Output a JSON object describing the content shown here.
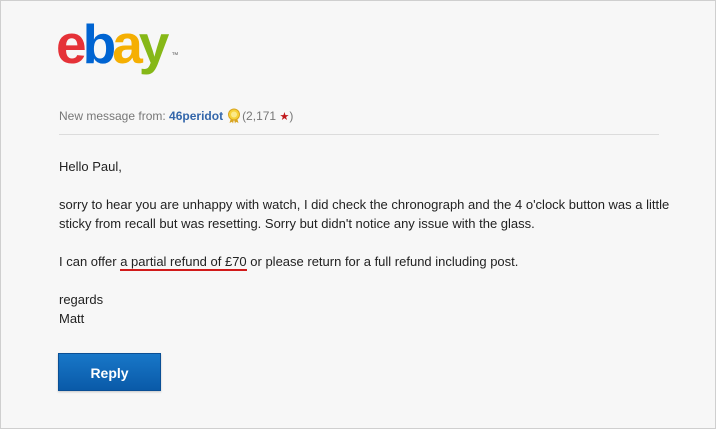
{
  "logo": {
    "letters": [
      {
        "char": "e",
        "color": "#e53238"
      },
      {
        "char": "b",
        "color": "#0064d2"
      },
      {
        "char": "a",
        "color": "#f5af02"
      },
      {
        "char": "y",
        "color": "#86b817"
      }
    ],
    "tm": "™"
  },
  "header": {
    "prefix": "New message from:",
    "sender": "46peridot",
    "feedback_open": "(2,171",
    "feedback_close": ")",
    "star": "★"
  },
  "message": {
    "greeting": "Hello Paul,",
    "para1": "sorry to hear you are unhappy with watch, I did check the chronograph and the 4 o'clock button was a little sticky from recall but was resetting. Sorry but didn't notice any issue with the glass.",
    "para2_before": "I can offer ",
    "para2_highlight": "a partial refund of £70",
    "para2_after": " or please return for a full refund including post.",
    "signoff": "regards",
    "signature": "Matt"
  },
  "actions": {
    "reply_label": "Reply"
  },
  "colors": {
    "sender_link": "#3366aa",
    "star": "#c0171a",
    "underline": "#d11a1a",
    "button": "#0a5aa8"
  }
}
